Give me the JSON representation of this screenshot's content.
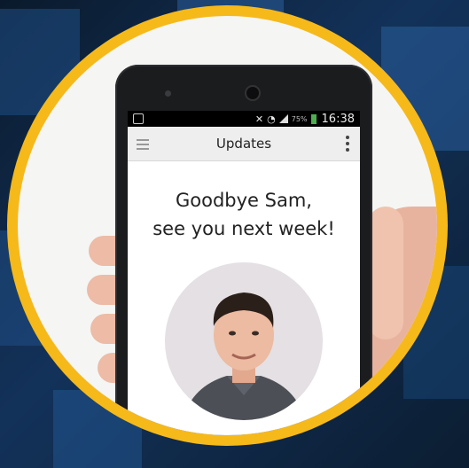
{
  "status_bar": {
    "battery_percent": "75%",
    "time": "16:38"
  },
  "app_bar": {
    "title": "Updates",
    "menu_icon": "hamburger-menu-icon",
    "overflow_icon": "vertical-ellipsis-icon"
  },
  "message": {
    "line1": "Goodbye Sam,",
    "line2": "see you next week!"
  },
  "colors": {
    "ring": "#f6b91a",
    "background": "#13325a"
  }
}
